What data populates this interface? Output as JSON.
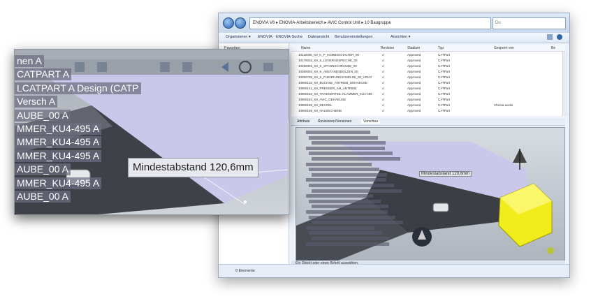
{
  "explorer": {
    "address": "ENOVIA V6  ▸  ENOVIA-Arbeitsbereich  ▸  AVIC Control Unit  ▸  10 Baugruppe",
    "search_placeholder": "Du",
    "toolbar": [
      "Organisieren ▾",
      "ENOVIA",
      "ENOVIA-Suche",
      "Dateiansicht",
      "Benutzereinstellungen",
      "Ansichten ▾"
    ],
    "sidebar_favorites": "Favoriten",
    "columns": [
      "Name",
      "Revision",
      "Stadium",
      "Typ",
      "Gesperrt von",
      "Be"
    ],
    "rows": [
      {
        "name": "10110006_K0_K_P_KOMBISCHALTER_00",
        "rev": "A",
        "state": "Approved",
        "type": "CATPart",
        "locked": ""
      },
      {
        "name": "10170016_K0_K_LENKRADSPEICHE_00",
        "rev": "A",
        "state": "Approved",
        "type": "CATPart",
        "locked": ""
      },
      {
        "name": "10350001_K0_K_SPANNSCHRAUBE_00",
        "rev": "A",
        "state": "Approved",
        "type": "CATPart",
        "locked": ""
      },
      {
        "name": "10380004_K0_K_ABSTANDSBOLZEN_00",
        "rev": "A",
        "state": "Approved",
        "type": "CATPart",
        "locked": ""
      },
      {
        "name": "10382705_K0_K_FUEHRUNGSHUELSE_00_HOLD",
        "rev": "A",
        "state": "Approved",
        "type": "CATPart",
        "locked": ""
      },
      {
        "name": "10900133_K0_BUCHSE_ANTRIEB_GEHAEUSE",
        "rev": "A",
        "state": "Approved",
        "type": "CATPart",
        "locked": ""
      },
      {
        "name": "10900141_K0_PRESSER_AM_ANTRIEB",
        "rev": "A",
        "state": "Approved",
        "type": "CATPart",
        "locked": ""
      },
      {
        "name": "10900153_K0_TRAEGERTEIL-KLAMMER_KU4-495",
        "rev": "A",
        "state": "Approved",
        "type": "CATPart",
        "locked": ""
      },
      {
        "name": "10900164_K0_AVIC_GEHAEUSE",
        "rev": "A",
        "state": "Approved",
        "type": "CATPart",
        "locked": ""
      },
      {
        "name": "10900166_K0_DECKEL",
        "rev": "A",
        "state": "Approved",
        "type": "CATPart",
        "locked": "Christa auslin"
      },
      {
        "name": "10900168_K0_HALBSCHIENE",
        "rev": "A",
        "state": "Approved",
        "type": "CATPart",
        "locked": ""
      }
    ],
    "tabs": [
      "Attribute",
      "Revisionen/Versionen",
      "Vorschau"
    ],
    "preview_measure": "Mindestabstand 120,6mm",
    "status": "Ein Objekt oder einen Befehl auswählen.",
    "item_count": "0 Elemente"
  },
  "zoom": {
    "tree": [
      "nen A",
      "CATPART A",
      "LCATPART A Design (CATP",
      "Versch A",
      "AUBE_00 A",
      "MMER_KU4-495 A",
      "MMER_KU4-495 A",
      "MMER_KU4-495 A",
      "AUBE_00 A",
      "MMER_KU4-495 A",
      "AUBE_00 A"
    ],
    "measure": "Mindestabstand 120,6mm"
  },
  "colors": {
    "highlight_face": "#c9c8ea",
    "part_yellow": "#f1ec1c",
    "bg_gray": "#c6ccd4"
  }
}
